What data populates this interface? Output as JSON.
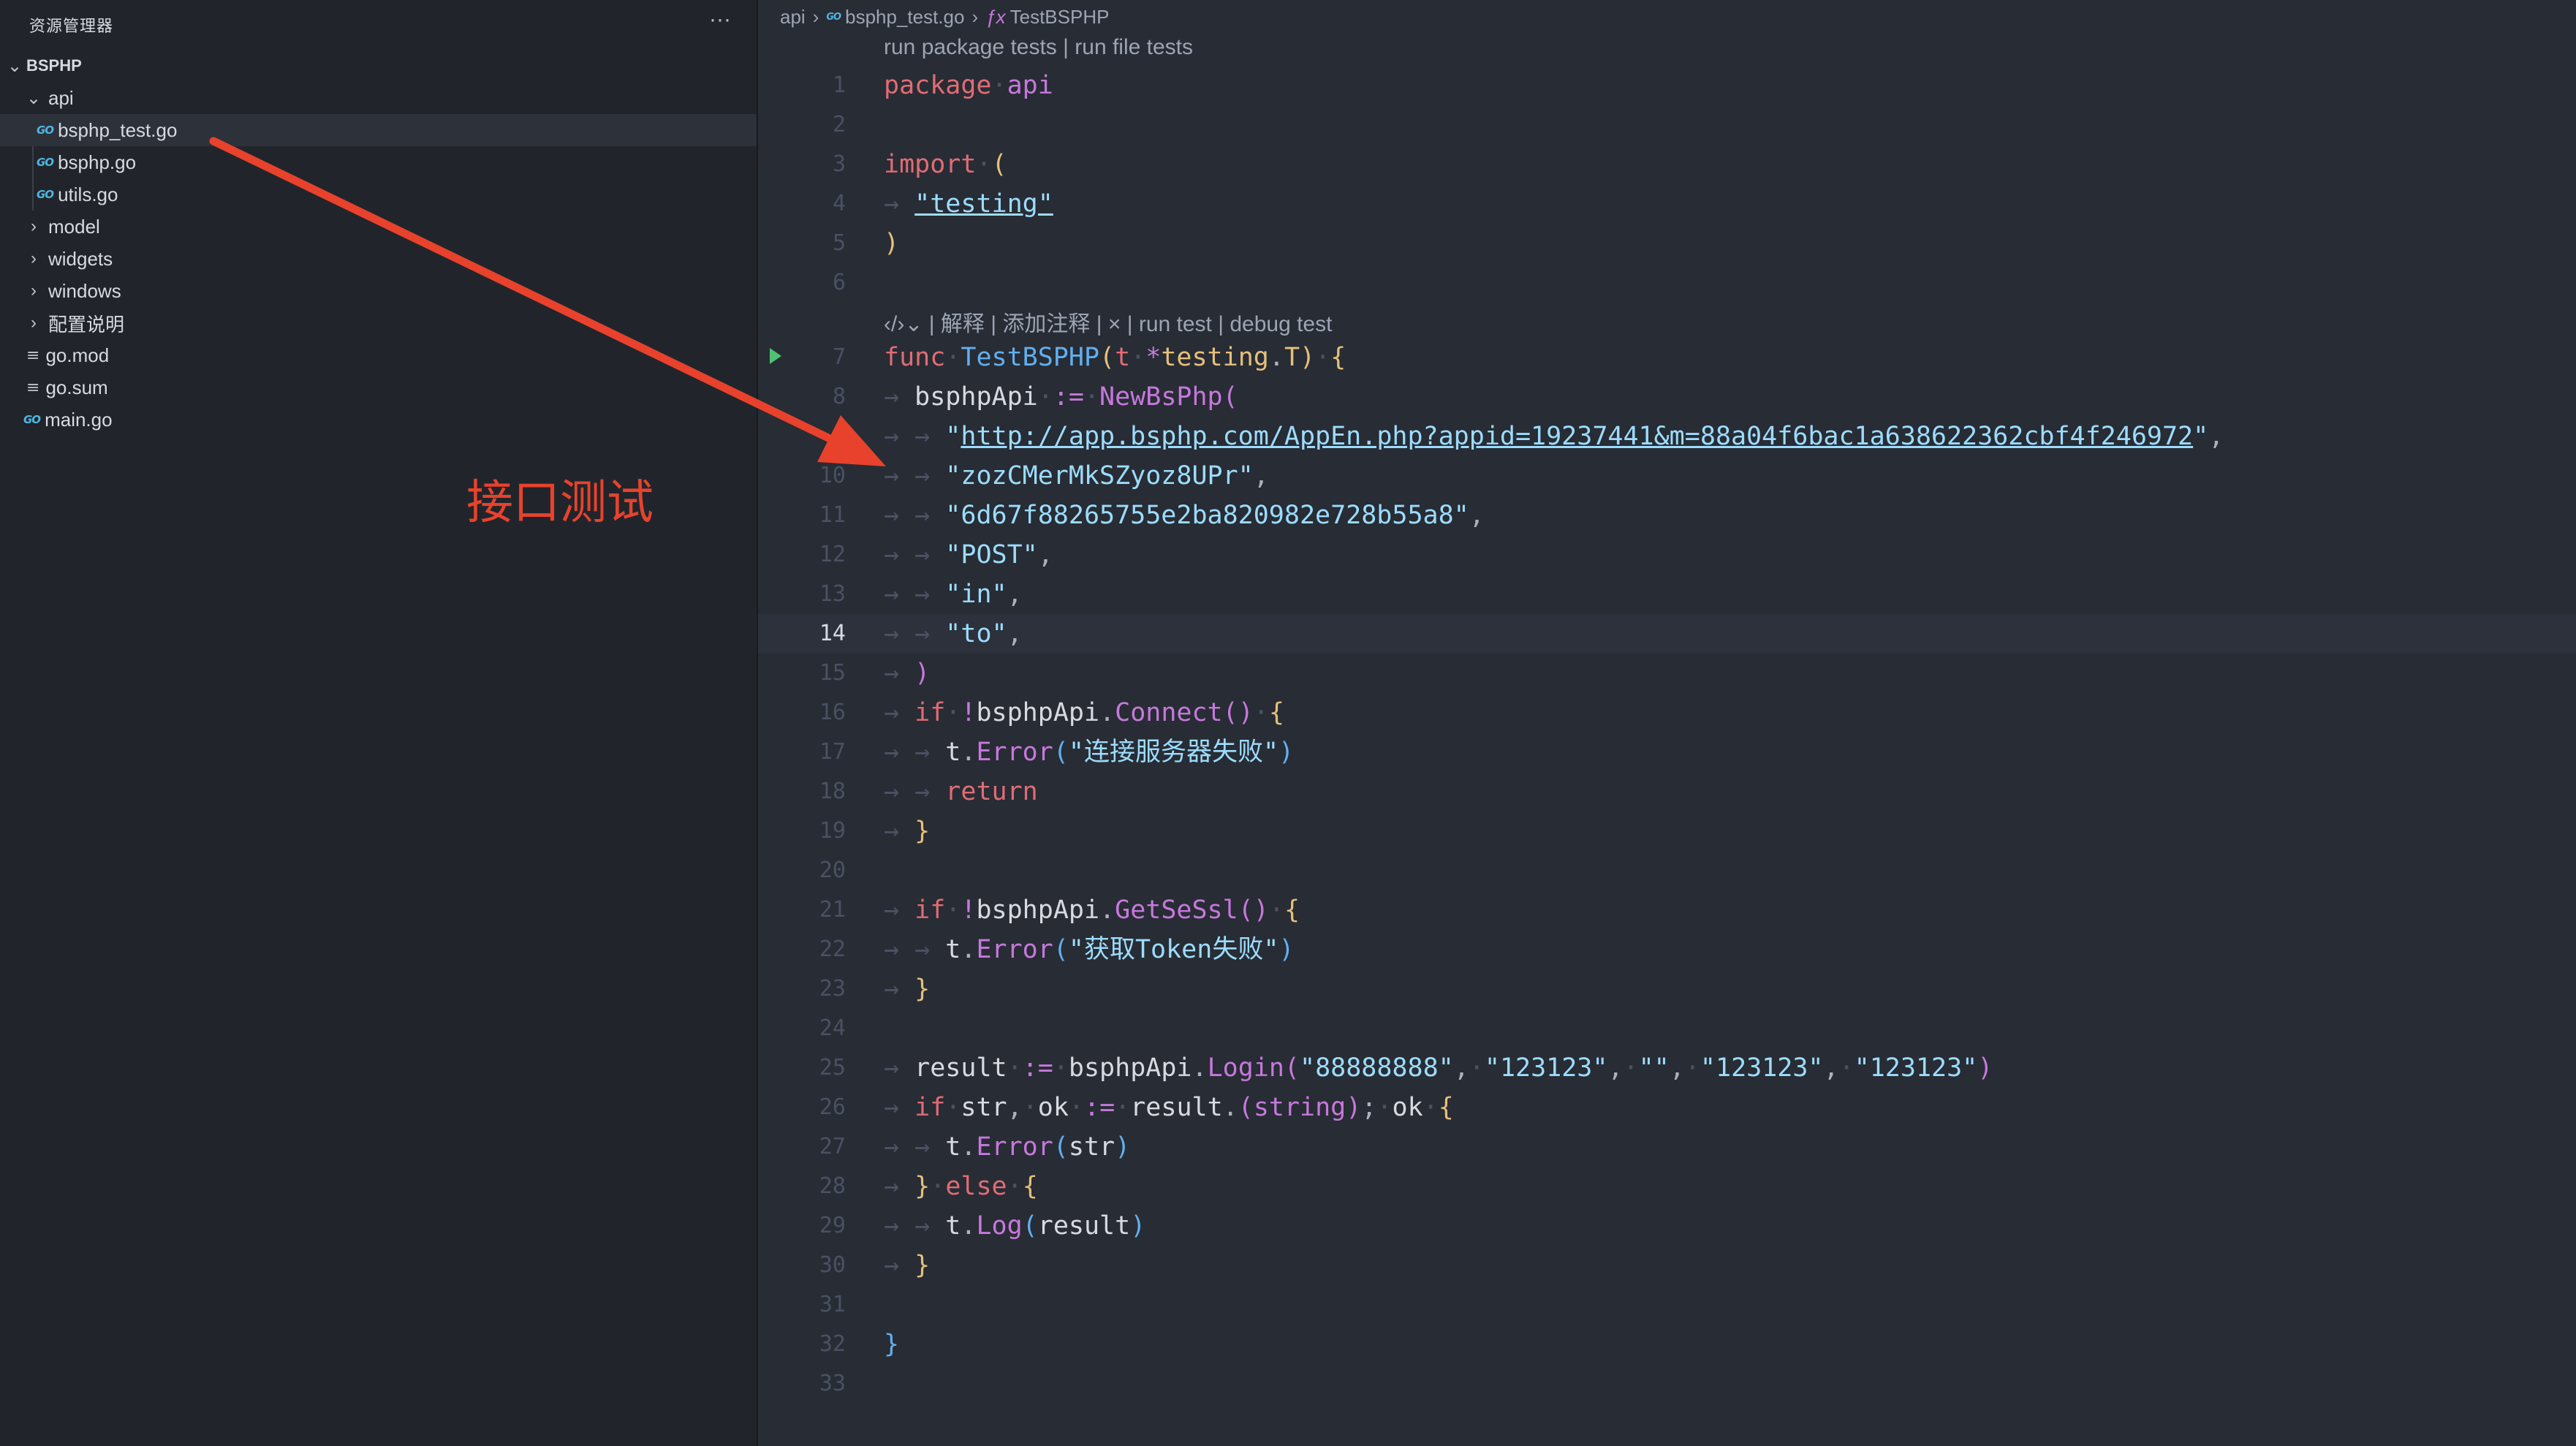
{
  "explorer": {
    "title": "资源管理器",
    "more": "···",
    "root": "BSPHP",
    "items": [
      {
        "label": "api",
        "kind": "folder-open"
      },
      {
        "label": "bsphp_test.go",
        "kind": "go"
      },
      {
        "label": "bsphp.go",
        "kind": "go"
      },
      {
        "label": "utils.go",
        "kind": "go"
      },
      {
        "label": "model",
        "kind": "folder"
      },
      {
        "label": "widgets",
        "kind": "folder"
      },
      {
        "label": "windows",
        "kind": "folder"
      },
      {
        "label": "配置说明",
        "kind": "folder"
      },
      {
        "label": "go.mod",
        "kind": "file"
      },
      {
        "label": "go.sum",
        "kind": "file"
      },
      {
        "label": "main.go",
        "kind": "go"
      }
    ],
    "go_icon": "GO",
    "chevron_open": "⌄",
    "chevron_closed": "›",
    "file_icon": "≡"
  },
  "annotation": {
    "text": "接口测试",
    "color": "#e8422c"
  },
  "breadcrumb": {
    "items": [
      "api",
      "bsphp_test.go",
      "TestBSPHP"
    ],
    "sep": "›",
    "fx_icon": "ƒx"
  },
  "codelens": {
    "top": "run package tests | run file tests",
    "func": "‹/›⌄ | 解释 | 添加注释 | × | run test | debug test"
  },
  "editor": {
    "current_line": 14,
    "lines": [
      {
        "n": "1"
      },
      {
        "n": "2"
      },
      {
        "n": "3"
      },
      {
        "n": "4"
      },
      {
        "n": "5"
      },
      {
        "n": "6"
      },
      {
        "n": "7"
      },
      {
        "n": "8"
      },
      {
        "n": "9"
      },
      {
        "n": "10"
      },
      {
        "n": "11"
      },
      {
        "n": "12"
      },
      {
        "n": "13"
      },
      {
        "n": "14"
      },
      {
        "n": "15"
      },
      {
        "n": "16"
      },
      {
        "n": "17"
      },
      {
        "n": "18"
      },
      {
        "n": "19"
      },
      {
        "n": "20"
      },
      {
        "n": "21"
      },
      {
        "n": "22"
      },
      {
        "n": "23"
      },
      {
        "n": "24"
      },
      {
        "n": "25"
      },
      {
        "n": "26"
      },
      {
        "n": "27"
      },
      {
        "n": "28"
      },
      {
        "n": "29"
      },
      {
        "n": "30"
      },
      {
        "n": "31"
      },
      {
        "n": "32"
      },
      {
        "n": "33"
      }
    ],
    "tokens": {
      "l1_kw": "package",
      "l1_id": "api",
      "l3_kw": "import",
      "l3_p": "(",
      "l4_s": "\"testing\"",
      "l5_p": ")",
      "l7_kw": "func",
      "l7_fn": "TestBSPHP",
      "l7_p1": "(",
      "l7_t": "t",
      "l7_star": "*",
      "l7_pkg": "testing",
      "l7_dot": ".",
      "l7_ty": "T",
      "l7_p2": ")",
      "l7_b": "{",
      "l8_id": "bsphpApi",
      "l8_op": ":=",
      "l8_fn": "NewBsPhp",
      "l8_p": "(",
      "l9_q1": "\"",
      "l9_url": "http://app.bsphp.com/AppEn.php?appid=19237441&m=88a04f6bac1a638622362cbf4f246972",
      "l9_q2": "\"",
      "l9_c": ",",
      "l10_s": "\"zozCMerMkSZyoz8UPr\"",
      "l10_c": ",",
      "l11_s": "\"6d67f88265755e2ba820982e728b55a8\"",
      "l11_c": ",",
      "l12_s": "\"POST\"",
      "l12_c": ",",
      "l13_s": "\"in\"",
      "l13_c": ",",
      "l14_s": "\"to\"",
      "l14_c": ",",
      "l15_p": ")",
      "l16_kw": "if",
      "l16_not": "!",
      "l16_id": "bsphpApi",
      "l16_dot": ".",
      "l16_fn": "Connect",
      "l16_p": "()",
      "l16_b": "{",
      "l17_id": "t",
      "l17_dot": ".",
      "l17_fn": "Error",
      "l17_p1": "(",
      "l17_s": "\"连接服务器失败\"",
      "l17_p2": ")",
      "l18_kw": "return",
      "l19_b": "}",
      "l21_kw": "if",
      "l21_not": "!",
      "l21_id": "bsphpApi",
      "l21_dot": ".",
      "l21_fn": "GetSeSsl",
      "l21_p": "()",
      "l21_b": "{",
      "l22_id": "t",
      "l22_dot": ".",
      "l22_fn": "Error",
      "l22_p1": "(",
      "l22_s": "\"获取Token失败\"",
      "l22_p2": ")",
      "l23_b": "}",
      "l25_id": "result",
      "l25_op": ":=",
      "l25_id2": "bsphpApi",
      "l25_dot": ".",
      "l25_fn": "Login",
      "l25_p1": "(",
      "l25_s1": "\"88888888\"",
      "l25_s2": "\"123123\"",
      "l25_s3": "\"\"",
      "l25_s4": "\"123123\"",
      "l25_s5": "\"123123\"",
      "l25_c": ",",
      "l25_p2": ")",
      "l26_kw": "if",
      "l26_id1": "str",
      "l26_c": ",",
      "l26_id2": "ok",
      "l26_op": ":=",
      "l26_id3": "result",
      "l26_dot": ".",
      "l26_p1": "(",
      "l26_ty": "string",
      "l26_p2": ")",
      "l26_semi": ";",
      "l26_id4": "ok",
      "l26_b": "{",
      "l27_id": "t",
      "l27_dot": ".",
      "l27_fn": "Error",
      "l27_p1": "(",
      "l27_arg": "str",
      "l27_p2": ")",
      "l28_b1": "}",
      "l28_kw": "else",
      "l28_b2": "{",
      "l29_id": "t",
      "l29_dot": ".",
      "l29_fn": "Log",
      "l29_p1": "(",
      "l29_arg": "result",
      "l29_p2": ")",
      "l30_b": "}",
      "l32_b": "}"
    }
  }
}
